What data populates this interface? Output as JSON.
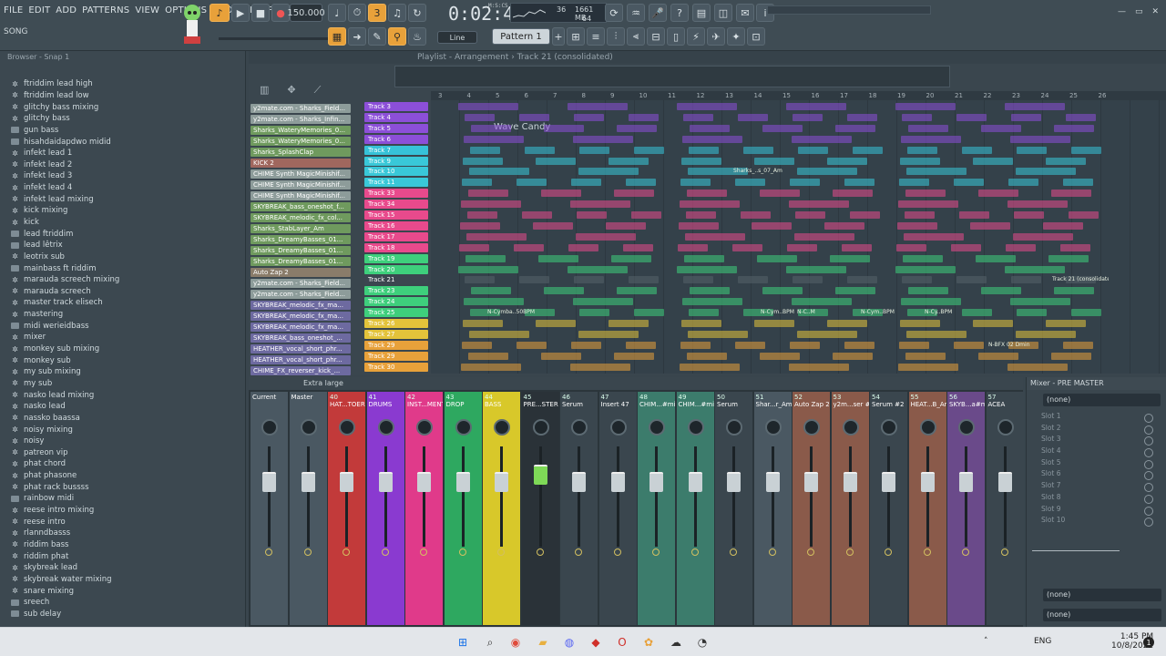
{
  "menu": {
    "items": [
      "FILE",
      "EDIT",
      "ADD",
      "PATTERNS",
      "VIEW",
      "OPTIONS",
      "TOOLS",
      "HELP"
    ]
  },
  "song_label": "SONG",
  "tempo": "150.000",
  "time": "0:02:40",
  "time_unit": "M:S:CS",
  "monitor": {
    "cpu": "36",
    "mem": "1661 MB",
    "poly": "64"
  },
  "pattern": {
    "label": "Pattern 1",
    "snap": "Line"
  },
  "browser": {
    "header": "Browser - Snap 1",
    "items": [
      {
        "icon": "gear",
        "label": "ftriddim lead high"
      },
      {
        "icon": "gear",
        "label": "ftriddim lead low"
      },
      {
        "icon": "gear",
        "label": "glitchy bass mixing"
      },
      {
        "icon": "gear",
        "label": "glitchy bass"
      },
      {
        "icon": "folder",
        "label": "gun bass"
      },
      {
        "icon": "folder",
        "label": "hisahdaidapdwo midid"
      },
      {
        "icon": "gear",
        "label": "infekt lead 1"
      },
      {
        "icon": "gear",
        "label": "infekt lead 2"
      },
      {
        "icon": "gear",
        "label": "infekt lead 3"
      },
      {
        "icon": "gear",
        "label": "infekt lead 4"
      },
      {
        "icon": "gear",
        "label": "infekt lead mixing"
      },
      {
        "icon": "gear",
        "label": "kick mixing"
      },
      {
        "icon": "gear",
        "label": "kick"
      },
      {
        "icon": "folder",
        "label": "lead ftriddim"
      },
      {
        "icon": "folder",
        "label": "lead lêtrix"
      },
      {
        "icon": "gear",
        "label": "leotrix sub"
      },
      {
        "icon": "folder",
        "label": "mainbass ft riddim"
      },
      {
        "icon": "gear",
        "label": "marauda screech mixing"
      },
      {
        "icon": "gear",
        "label": "marauda screech"
      },
      {
        "icon": "gear",
        "label": "master track elisech"
      },
      {
        "icon": "gear",
        "label": "mastering"
      },
      {
        "icon": "folder",
        "label": "midi werieidbass"
      },
      {
        "icon": "gear",
        "label": "mixer"
      },
      {
        "icon": "gear",
        "label": "monkey sub mixing"
      },
      {
        "icon": "gear",
        "label": "monkey sub"
      },
      {
        "icon": "gear",
        "label": "my sub mixing"
      },
      {
        "icon": "gear",
        "label": "my sub"
      },
      {
        "icon": "gear",
        "label": "nasko lead mixing"
      },
      {
        "icon": "gear",
        "label": "nasko lead"
      },
      {
        "icon": "gear",
        "label": "nassko baassa"
      },
      {
        "icon": "gear",
        "label": "noisy mixing"
      },
      {
        "icon": "gear",
        "label": "noisy"
      },
      {
        "icon": "gear",
        "label": "patreon vip"
      },
      {
        "icon": "gear",
        "label": "phat chord"
      },
      {
        "icon": "gear",
        "label": "phat phasone"
      },
      {
        "icon": "gear",
        "label": "phat rack bussss"
      },
      {
        "icon": "folder",
        "label": "rainbow midi"
      },
      {
        "icon": "gear",
        "label": "reese intro mixing"
      },
      {
        "icon": "gear",
        "label": "reese intro"
      },
      {
        "icon": "gear",
        "label": "rlanndbasss"
      },
      {
        "icon": "gear",
        "label": "riddim bass"
      },
      {
        "icon": "gear",
        "label": "riddim phat"
      },
      {
        "icon": "gear",
        "label": "skybreak lead"
      },
      {
        "icon": "gear",
        "label": "skybreak water mixing"
      },
      {
        "icon": "gear",
        "label": "snare mixing"
      },
      {
        "icon": "folder",
        "label": "sreech"
      },
      {
        "icon": "folder",
        "label": "sub delay"
      }
    ]
  },
  "playlist": {
    "title": "Playlist - Arrangement › Track 21 (consolidated)",
    "ruler": [
      "3",
      "4",
      "5",
      "6",
      "7",
      "8",
      "9",
      "10",
      "11",
      "12",
      "13",
      "14",
      "15",
      "16",
      "17",
      "18",
      "19",
      "20",
      "21",
      "22",
      "23",
      "24",
      "25",
      "26"
    ],
    "annotation": "Wave Candy",
    "patterns": [
      {
        "label": "y2mate.com - Sharks_Field...",
        "color": "#8d9c9a"
      },
      {
        "label": "y2mate.com - Sharks_Infin...",
        "color": "#8d9c9a"
      },
      {
        "label": "Sharks_WateryMemories_0...",
        "color": "#6f9a5e"
      },
      {
        "label": "Sharks_WateryMemories_0...",
        "color": "#6f9a5e"
      },
      {
        "label": "Sharks_SplashClap",
        "color": "#6f9a5e"
      },
      {
        "label": "KICK 2",
        "color": "#a0675e"
      },
      {
        "label": "CHIME Synth MagicMinishif...",
        "color": "#8d9c9a"
      },
      {
        "label": "CHIME Synth MagicMinishif...",
        "color": "#8d9c9a"
      },
      {
        "label": "CHIME Synth MagicMinishif...",
        "color": "#8d9c9a"
      },
      {
        "label": "SKYBREAK_bass_oneshot_f...",
        "color": "#6f9a5e"
      },
      {
        "label": "SKYBREAK_melodic_fx_col...",
        "color": "#6f9a5e"
      },
      {
        "label": "Sharks_StabLayer_Am",
        "color": "#6f9a5e"
      },
      {
        "label": "Sharks_DreamyBasses_01...",
        "color": "#6f9a5e"
      },
      {
        "label": "Sharks_DreamyBasses_01...",
        "color": "#6f9a5e"
      },
      {
        "label": "Sharks_DreamyBasses_01...",
        "color": "#6f9a5e"
      },
      {
        "label": "Auto Zap 2",
        "color": "#8a7c6a"
      },
      {
        "label": "y2mate.com - Sharks_Field...",
        "color": "#8d9c9a"
      },
      {
        "label": "y2mate.com - Sharks_Field...",
        "color": "#8d9c9a"
      },
      {
        "label": "SKYBREAK_melodic_fx_ma...",
        "color": "#6d6aa0"
      },
      {
        "label": "SKYBREAK_melodic_fx_ma...",
        "color": "#6d6aa0"
      },
      {
        "label": "SKYBREAK_melodic_fx_ma...",
        "color": "#6d6aa0"
      },
      {
        "label": "SKYBREAK_bass_oneshot_...",
        "color": "#6d6aa0"
      },
      {
        "label": "HEATHER_vocal_short_phr...",
        "color": "#6d6aa0"
      },
      {
        "label": "HEATHER_vocal_short_phr...",
        "color": "#6d6aa0"
      },
      {
        "label": "CHIME_FX_reverser_kick_...",
        "color": "#6d6aa0"
      }
    ],
    "tracks": [
      {
        "label": "Track 3",
        "color": "#8c4fd8"
      },
      {
        "label": "Track 4",
        "color": "#8c4fd8"
      },
      {
        "label": "Track 5",
        "color": "#8c4fd8"
      },
      {
        "label": "Track 6",
        "color": "#8c4fd8"
      },
      {
        "label": "Track 7",
        "color": "#36c2d8"
      },
      {
        "label": "Track 9",
        "color": "#39c8d8"
      },
      {
        "label": "Track 10",
        "color": "#39c8d8"
      },
      {
        "label": "Track 11",
        "color": "#39c8d8"
      },
      {
        "label": "Track 33",
        "color": "#e84a8c"
      },
      {
        "label": "Track 34",
        "color": "#e84a8c"
      },
      {
        "label": "Track 15",
        "color": "#e84a8c"
      },
      {
        "label": "Track 16",
        "color": "#e84a8c"
      },
      {
        "label": "Track 17",
        "color": "#e84a8c"
      },
      {
        "label": "Track 18",
        "color": "#e84a8c"
      },
      {
        "label": "Track 19",
        "color": "#3ecf7c"
      },
      {
        "label": "Track 20",
        "color": "#3ecf7c"
      },
      {
        "label": "Track 21",
        "color": "#3c4650"
      },
      {
        "label": "Track 23",
        "color": "#3ecf7c"
      },
      {
        "label": "Track 24",
        "color": "#3ecf7c"
      },
      {
        "label": "Track 25",
        "color": "#3ecf7c"
      },
      {
        "label": "Track 26",
        "color": "#e3c33a"
      },
      {
        "label": "Track 27",
        "color": "#e3c33a"
      },
      {
        "label": "Track 29",
        "color": "#e8a13a"
      },
      {
        "label": "Track 29",
        "color": "#e8a13a"
      },
      {
        "label": "Track 30",
        "color": "#e8a13a"
      }
    ],
    "clip_texts": [
      "Sharks_..s_07_Am",
      "N-C..M",
      "N-Cym..BPM",
      "N-Cy..BPM",
      "N-Cymba..50BPM",
      "N-Cym..BPM",
      "N-BFX 02 Dmin",
      "Track 21 (consolidated)"
    ]
  },
  "mixer": {
    "header": "Extra large",
    "channels": [
      {
        "num": "",
        "name": "Current",
        "color": "#4a5862"
      },
      {
        "num": "",
        "name": "Master",
        "color": "#4a5862"
      },
      {
        "num": "40",
        "name": "HAT...TOERS",
        "color": "#c23a3a"
      },
      {
        "num": "41",
        "name": "DRUMS",
        "color": "#8a3ad0"
      },
      {
        "num": "42",
        "name": "INST...MENTS",
        "color": "#e03a8a"
      },
      {
        "num": "43",
        "name": "DROP",
        "color": "#2ea860"
      },
      {
        "num": "44",
        "name": "BASS",
        "color": "#d8c82a"
      },
      {
        "num": "45",
        "name": "PRE...STER",
        "color": "#2a3238"
      },
      {
        "num": "46",
        "name": "Serum",
        "color": "#3a464e"
      },
      {
        "num": "47",
        "name": "Insert 47",
        "color": "#3a464e"
      },
      {
        "num": "48",
        "name": "CHIM...#min",
        "color": "#3c7c6c"
      },
      {
        "num": "49",
        "name": "CHIM...#min",
        "color": "#3c7c6c"
      },
      {
        "num": "50",
        "name": "Serum",
        "color": "#3a464e"
      },
      {
        "num": "51",
        "name": "Shar...r_Am",
        "color": "#4a5862"
      },
      {
        "num": "52",
        "name": "Auto Zap 2",
        "color": "#8a5a4a"
      },
      {
        "num": "53",
        "name": "y2m...ser #3",
        "color": "#8a5a4a"
      },
      {
        "num": "54",
        "name": "Serum #2",
        "color": "#3a464e"
      },
      {
        "num": "55",
        "name": "HEAT...B_Am",
        "color": "#8a5a4a"
      },
      {
        "num": "56",
        "name": "SKYB...a#m",
        "color": "#6a4a8a"
      },
      {
        "num": "57",
        "name": "ACEA",
        "color": "#3a464e"
      }
    ]
  },
  "side_panel": {
    "title": "Mixer - PRE MASTER",
    "preset": "(none)",
    "slots": [
      "Slot 1",
      "Slot 2",
      "Slot 3",
      "Slot 4",
      "Slot 5",
      "Slot 6",
      "Slot 7",
      "Slot 8",
      "Slot 9",
      "Slot 10"
    ],
    "send1": "(none)",
    "send2": "(none)"
  },
  "taskbar": {
    "lang": "ENG",
    "time": "1:45 PM",
    "date": "10/8/2022"
  }
}
